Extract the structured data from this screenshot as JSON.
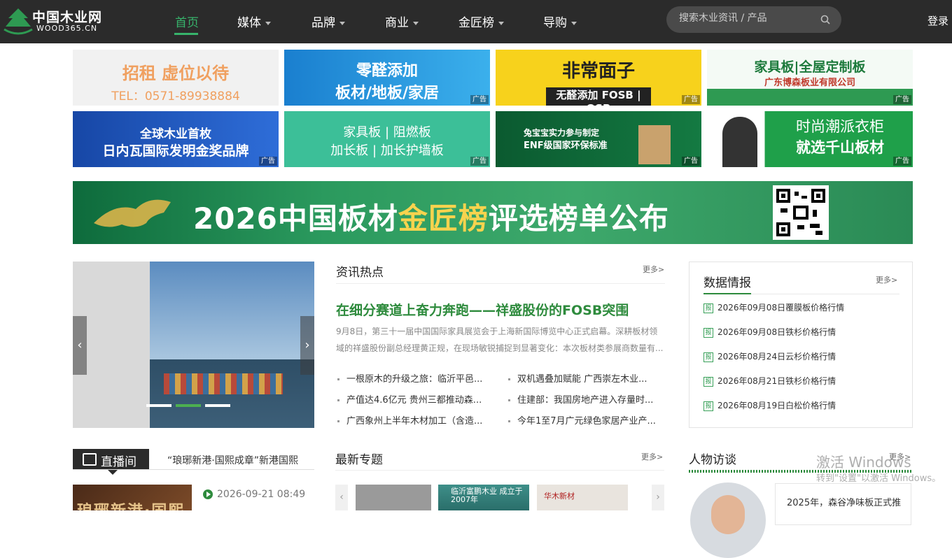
{
  "header": {
    "logo_cn": "中国木业网",
    "logo_en": "WOOD365.CN",
    "nav": [
      {
        "label": "首页",
        "active": true,
        "dropdown": false
      },
      {
        "label": "媒体",
        "active": false,
        "dropdown": true
      },
      {
        "label": "品牌",
        "active": false,
        "dropdown": true
      },
      {
        "label": "商业",
        "active": false,
        "dropdown": true
      },
      {
        "label": "金匠榜",
        "active": false,
        "dropdown": true
      },
      {
        "label": "导购",
        "active": false,
        "dropdown": true
      }
    ],
    "search_placeholder": "搜索木业资讯 / 产品",
    "login": "登录",
    "accent": "#37b36b"
  },
  "ads": [
    {
      "line1": "招租  虚位以待",
      "line2": "TEL：0571-89938884",
      "tag": "",
      "bg": "#f2f2f2"
    },
    {
      "line1": "零醛添加",
      "line2": "板材/地板/家居",
      "tag": "广告",
      "bg": "#1e8fd6"
    },
    {
      "line1": "非常面子",
      "line2": "无醛添加 FOSB | OSB",
      "tag": "广告",
      "bg": "#f7d21c"
    },
    {
      "line1": "家具板|全屋定制板",
      "line2": "广东博森板业有限公司",
      "tag": "广告",
      "bg": "#eef6f0"
    },
    {
      "line1": "全球木业首枚",
      "line2": "日内瓦国际发明金奖品牌",
      "tag": "广告",
      "bg": "#1a4fb0"
    },
    {
      "line1": "家具板 | 阻燃板",
      "line2": "加长板 | 加长护墙板",
      "tag": "广告",
      "bg": "#3cbf98"
    },
    {
      "line1": "兔宝宝实力参与制定",
      "line2": "ENF级国家环保标准",
      "tag": "广告",
      "bg": "#0f6e3a"
    },
    {
      "line1": "时尚潮派衣柜",
      "line2": "就选千山板材",
      "tag": "广告",
      "bg": "#1fa04a"
    }
  ],
  "banner": {
    "pre": "2026中国板材",
    "gold": "金匠榜",
    "post": "评选榜单公布"
  },
  "news": {
    "title": "资讯热点",
    "more": "更多>",
    "headline": "在细分赛道上奋力奔跑——祥盛股份的FOSB突围",
    "summary": "9月8日，第三十一届中国国际家具展览会于上海新国际博览中心正式启幕。深耕板材领域的祥盛股份副总经理黄正规，在现场敏锐捕捉到显著变化：本次板材类参展商数量有...",
    "items": [
      "一根原木的升级之旅：临沂平邑...",
      "双机遇叠加赋能 广西崇左木业...",
      "产值达4.6亿元 贵州三都推动森...",
      "住建部：我国房地产进入存量时...",
      "广西象州上半年木材加工（含造...",
      "今年1至7月广元绿色家居产业产..."
    ]
  },
  "data_report": {
    "title": "数据情报",
    "more": "更多>",
    "icon_label": "报",
    "items": [
      "2026年09月08日覆膜板价格行情",
      "2026年09月08日铁杉价格行情",
      "2026年08月24日云杉价格行情",
      "2026年08月21日铁杉价格行情",
      "2026年08月19日白松价格行情"
    ]
  },
  "live": {
    "label": "直播间",
    "news": "“琅琊新港·国熙成章”新港国熙",
    "img_text": "琅琊新港·国熙成章",
    "time": "2026-09-21 08:49"
  },
  "topics": {
    "title": "最新专题",
    "more": "更多>",
    "t2": "临沂富鹏木业 成立于2007年",
    "t3": "华木新材"
  },
  "interview": {
    "title": "人物访谈",
    "more": "更多>",
    "quote": "2025年，森谷净味板正式推"
  },
  "slider": {
    "active_index": 1,
    "count": 3
  },
  "watermark": {
    "line1": "激活 Windows",
    "line2": "转到\"设置\"以激活 Windows。"
  }
}
